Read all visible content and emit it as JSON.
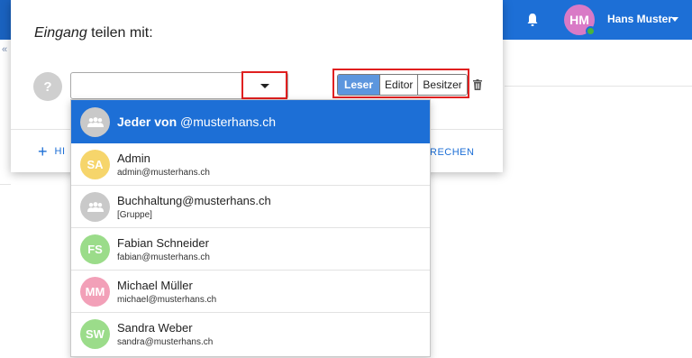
{
  "header": {
    "user_initials": "HM",
    "user_name": "Hans Muster",
    "avatar_color": "#d97ac6",
    "presence_color": "#49b53b",
    "accent": "#1d6fd6"
  },
  "dialog": {
    "title_doc": "Eingang",
    "title_rest": " teilen mit:",
    "help_icon_text": "?",
    "input": {
      "value": "",
      "placeholder": ""
    },
    "roles": [
      {
        "label": "Leser",
        "active": true
      },
      {
        "label": "Editor",
        "active": false
      },
      {
        "label": "Besitzer",
        "active": false
      }
    ],
    "add_link_partial": "HI",
    "cancel_link_partial": "RECHEN",
    "plus_symbol": "+"
  },
  "suggestions": [
    {
      "type": "group",
      "name_bold": "Jeder von",
      "name_rest": " @musterhans.ch",
      "sub": "",
      "avatar_color": "#c9c9c9",
      "highlight": true,
      "icon": "group-icon"
    },
    {
      "type": "user",
      "initials": "SA",
      "name": "Admin",
      "sub": "admin@musterhans.ch",
      "avatar_color": "#f6d56b"
    },
    {
      "type": "group",
      "name": "Buchhaltung@musterhans.ch",
      "sub": "[Gruppe]",
      "avatar_color": "#c9c9c9",
      "icon": "group-icon"
    },
    {
      "type": "user",
      "initials": "FS",
      "name": "Fabian Schneider",
      "sub": "fabian@musterhans.ch",
      "avatar_color": "#9bdc8a"
    },
    {
      "type": "user",
      "initials": "MM",
      "name": "Michael Müller",
      "sub": "michael@musterhans.ch",
      "avatar_color": "#f2a0b8"
    },
    {
      "type": "user",
      "initials": "SW",
      "name": "Sandra Weber",
      "sub": "sandra@musterhans.ch",
      "avatar_color": "#9bdc8a"
    }
  ]
}
